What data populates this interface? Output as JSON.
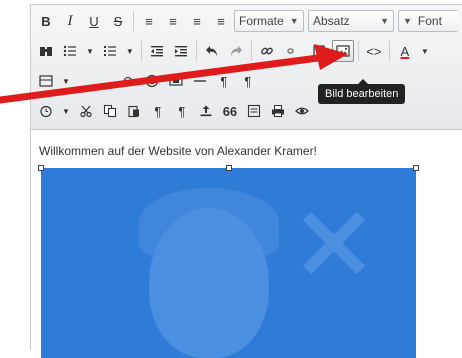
{
  "toolbar": {
    "row1": {
      "bold": "B",
      "italic": "I",
      "underline": "U",
      "strike": "S",
      "align_left": "≡",
      "align_center": "≡",
      "align_right": "≡",
      "align_justify": "≡",
      "formate_label": "Formate",
      "absatz_label": "Absatz",
      "font_label": "Font"
    },
    "row2": {
      "tooltip": "Bild bearbeiten",
      "code": "<>",
      "text_color": "A"
    },
    "row3": {
      "omega": "Ω",
      "pilcrow1": "¶",
      "pilcrow2": "¶"
    },
    "row4": {
      "para1": "¶",
      "para2": "¶",
      "quote": "66"
    }
  },
  "content": {
    "welcome_text": "Willkommen auf der Website von Alexander Kramer!"
  },
  "colors": {
    "accent_red": "#e01b1b",
    "image_blue": "#2f7bd8"
  }
}
